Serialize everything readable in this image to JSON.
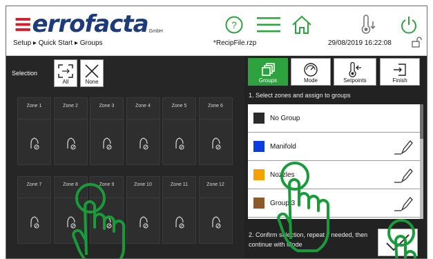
{
  "header": {
    "logo_text": "ferrofacta",
    "logo_tm": "GmbH",
    "breadcrumb": "Setup ▸ Quick Start ▸ Groups",
    "file_name": "*RecipFile.rzp",
    "datetime": "29/08/2019 16:22:08",
    "icons": [
      "help-icon",
      "menu-icon",
      "home-icon",
      "temperature-icon",
      "power-icon",
      "lock-icon"
    ],
    "accent_color": "#2fa240"
  },
  "selection": {
    "label": "Selection",
    "all_label": "All",
    "none_label": "None"
  },
  "zones": [
    {
      "name": "Zone 1"
    },
    {
      "name": "Zone 2"
    },
    {
      "name": "Zone 3"
    },
    {
      "name": "Zone 4"
    },
    {
      "name": "Zone 5"
    },
    {
      "name": "Zone 6"
    },
    {
      "name": "Zone 7"
    },
    {
      "name": "Zone 8"
    },
    {
      "name": "Zone 9"
    },
    {
      "name": "Zone 10"
    },
    {
      "name": "Zone 11"
    },
    {
      "name": "Zone 12"
    }
  ],
  "tabs": [
    {
      "label": "Groups",
      "icon": "groups-icon",
      "active": true
    },
    {
      "label": "Mode",
      "icon": "mode-icon",
      "active": false
    },
    {
      "label": "Setpoints",
      "icon": "setpoints-icon",
      "active": false
    },
    {
      "label": "Finish",
      "icon": "finish-icon",
      "active": false
    }
  ],
  "instruction_1": "1. Select zones and assign to groups",
  "groups": [
    {
      "name": "No Group",
      "color": "#2b2b2b",
      "editable": false
    },
    {
      "name": "Manifold",
      "color": "#0a3de0",
      "editable": true
    },
    {
      "name": "Nozzles",
      "color": "#f5a100",
      "editable": true
    },
    {
      "name": "Group 3",
      "color": "#8a5a2b",
      "editable": true
    }
  ],
  "instruction_2": "2. Confirm selection, repeat if needed, then continue with Mode"
}
